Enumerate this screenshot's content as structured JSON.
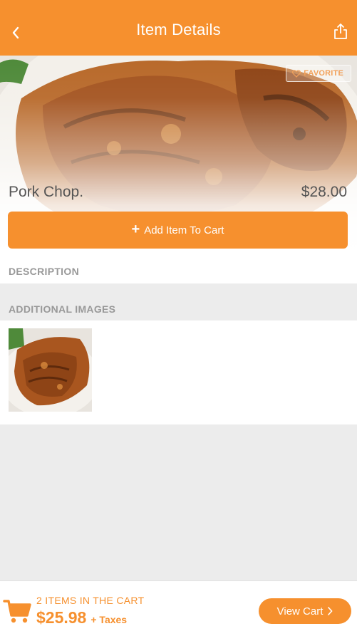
{
  "header": {
    "title": "Item Details",
    "back_icon": "chevron-left-icon",
    "share_icon": "share-icon",
    "background_color": "#f6902e"
  },
  "item": {
    "name": "Pork Chop.",
    "price": "$28.00",
    "favorite_label": "FAVORITE",
    "favorite_icon": "heart-outline-icon",
    "add_to_cart_label": "Add Item To Cart"
  },
  "sections": {
    "description_title": "DESCRIPTION",
    "additional_images_title": "ADDITIONAL IMAGES"
  },
  "cart": {
    "count_label": "2 ITEMS IN THE CART",
    "total": "$25.98",
    "taxes_label": "+ Taxes",
    "view_cart_label": "View Cart",
    "cart_icon": "shopping-cart-icon",
    "accent_color": "#f6902e"
  }
}
